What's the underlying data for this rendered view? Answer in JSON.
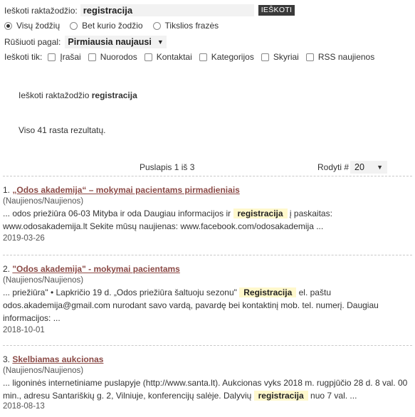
{
  "search": {
    "label": "Ieškoti raktažodžio:",
    "value": "registracija",
    "button": "IEŠKOTI",
    "modes": [
      {
        "label": "Visų žodžių",
        "checked": true
      },
      {
        "label": "Bet kurio žodžio",
        "checked": false
      },
      {
        "label": "Tikslios frazės",
        "checked": false
      }
    ],
    "sort_label": "Rūšiuoti pagal:",
    "sort_value": "Pirmiausia naujausi",
    "filter_label": "Ieškoti tik:",
    "filters": [
      "Įrašai",
      "Nuorodos",
      "Kontaktai",
      "Kategorijos",
      "Skyriai",
      "RSS naujienos"
    ]
  },
  "summary": {
    "query_prefix": "Ieškoti raktažodžio",
    "query": "registracija",
    "count_text": "Viso 41 rasta rezultatų."
  },
  "pagination": {
    "page_text": "Puslapis 1 iš 3",
    "show_label": "Rodyti #",
    "show_value": "20"
  },
  "results": [
    {
      "num": "1.",
      "title": "„Odos akademija“ – mokymai pacientams pirmadieniais",
      "category": "(Naujienos/Naujienos)",
      "s1": "... odos priežiūra 06-03 Mityba ir oda  Daugiau informacijos ir",
      "hl": "registracija",
      "s2": "į paskaitas:",
      "s3": "www.odosakademija.lt Sekite mūsų naujienas: www.facebook.com/odosakademija  ...",
      "date": "2019-03-26"
    },
    {
      "num": "2.",
      "title": "\"Odos akademija\" - mokymai pacientams",
      "category": "(Naujienos/Naujienos)",
      "s1": "... priežiūra\" • Lapkričio 19 d. „Odos priežiūra šaltuoju sezonu\"",
      "hl": "Registracija",
      "s2": "el. paštu",
      "s3": "odos.akademija@gmail.com nurodant savo vardą, pavardę bei kontaktinį mob. tel. numerį. Daugiau informacijos: ...",
      "date": "2018-10-01"
    },
    {
      "num": "3.",
      "title": "Skelbiamas aukcionas",
      "category": "(Naujienos/Naujienos)",
      "s1": "... ligoninės internetiniame puslapyje (http://www.santa.lt). Aukcionas vyks 2018 m. rugpjūčio 28 d. 8 val. 00 min., adresu Santariškių g. 2, Vilniuje, konferencijų salėje. Dalyvių",
      "hl": "registracija",
      "s2": "nuo 7 val. ...",
      "s3": "",
      "date": "2018-08-13"
    }
  ]
}
